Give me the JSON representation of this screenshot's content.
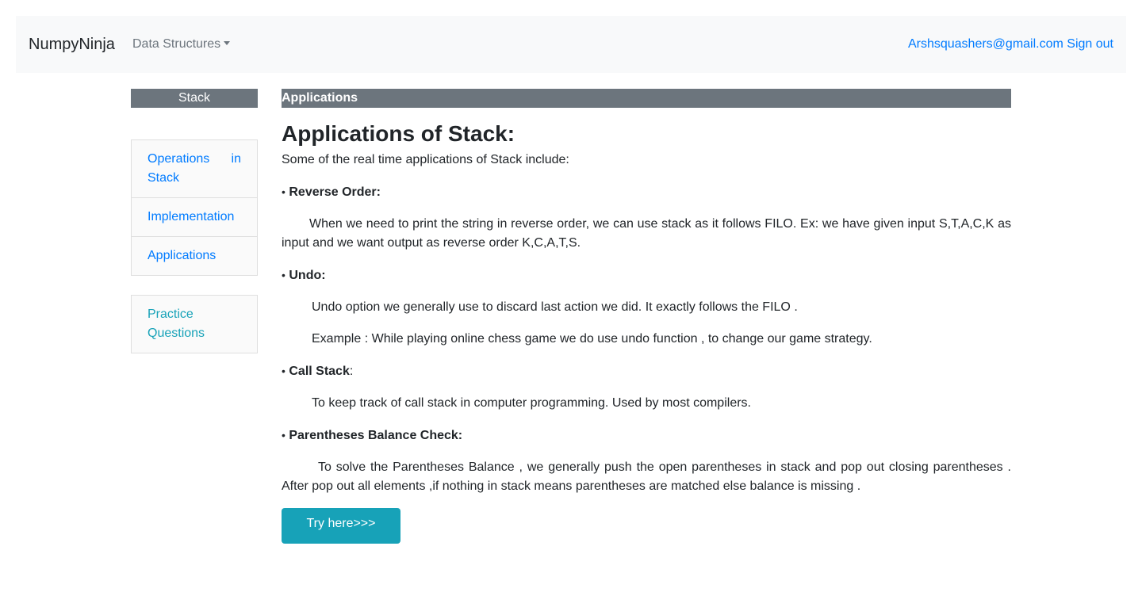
{
  "navbar": {
    "brand": "NumpyNinja",
    "dropdown_label": "Data Structures",
    "user_email": "Arshsquashers@gmail.com",
    "signout_label": "Sign out"
  },
  "sidebar": {
    "header": "Stack",
    "items": [
      {
        "label_part1": "Operations",
        "label_part2": "in",
        "label_part3": "Stack"
      },
      {
        "label": "Implementation"
      },
      {
        "label": "Applications"
      }
    ],
    "practice_label": "Practice Questions"
  },
  "content": {
    "header": "Applications",
    "title": "Applications of Stack:",
    "intro": "Some of the real time applications of Stack include:",
    "bullet": "•",
    "sections": [
      {
        "heading": "Reverse Order:",
        "paragraphs": [
          "When we need to print the string in reverse order, we can use stack as it follows FILO. Ex: we have given input S,T,A,C,K as input and we want output as reverse order  K,C,A,T,S."
        ]
      },
      {
        "heading": "Undo:",
        "paragraphs": [
          "Undo option we generally use to discard last action we did.  It exactly follows the FILO .",
          "Example : While playing online chess game we do use undo function , to change our game strategy."
        ]
      },
      {
        "heading": "Call Stack",
        "suffix": ":",
        "paragraphs": [
          "To keep track of call stack in computer programming. Used by most compilers."
        ]
      },
      {
        "heading": "Parentheses Balance Check:",
        "paragraphs": [
          "To solve the Parentheses Balance , we generally push the open parentheses in stack and pop out closing parentheses . After pop out all elements ,if nothing in stack means parentheses are matched else  balance is missing  ."
        ]
      }
    ],
    "try_button": "Try here>>>"
  }
}
